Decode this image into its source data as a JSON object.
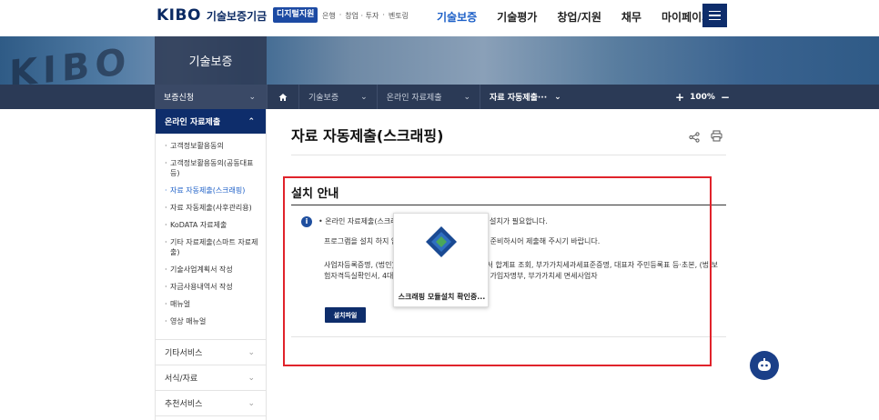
{
  "header": {
    "logo_mark": "KIBO",
    "logo_name": "기술보증기금",
    "digital_badge": "디지털지원",
    "sub_links": [
      "은행",
      "·",
      "창업 · 투자",
      "·",
      "벤토링"
    ],
    "nav": [
      "기술보증",
      "기술평가",
      "창업/지원",
      "채무",
      "마이페이지"
    ],
    "nav_active_index": 0,
    "menu_icon": "hamburger-icon"
  },
  "banner": {
    "title": "기술보증"
  },
  "breadcrumb": {
    "first": "보증신청",
    "items": [
      "기술보증",
      "온라인 자료제출",
      "자료 자동제출···"
    ],
    "zoom": "100%"
  },
  "sidebar": {
    "active_section": "온라인 자료제출",
    "sub_items": [
      "고객정보활용동의",
      "고객정보활용동의(공동대표등)",
      "자료 자동제출(스크래핑)",
      "자료 자동제출(사후관리용)",
      "KoDATA 자료제출",
      "기타 자료제출(스마트 자료제출)",
      "기술사업계획서 작성",
      "자금사용내역서 작성",
      "매뉴얼",
      "영상 매뉴얼"
    ],
    "selected_index": 2,
    "other_sections": [
      "기타서비스",
      "서식/자료",
      "추천서비스"
    ]
  },
  "main": {
    "page_title": "자료 자동제출(스크래핑)",
    "section_title": "설치 안내",
    "info_line1": "온라인 자료제출(스크래                                    램 설치가 필요합니다.",
    "info_line2": "프로그램을 설치 하지 않                                    접 준비하시어 제출해 주시기 바랍니다.",
    "info_line3": "사업자등록증명, (법인)                                    증명, 매입·매출처별 세금계산서 합계표 조회, 부가가치세과세표준증명, 대표자 주민등록표 등·초본, (법                                    보험자격득실확인서, 4대보험 완납증명서, 4대 사회보험 가입자명부, 부가가치세 면세사업자",
    "install_button": "설치파일"
  },
  "popup": {
    "text": "스크래핑 모듈설치 확인중..."
  },
  "colors": {
    "navy": "#0e2d6b",
    "accent_blue": "#1c5fc7",
    "highlight_red": "#e0232b"
  }
}
